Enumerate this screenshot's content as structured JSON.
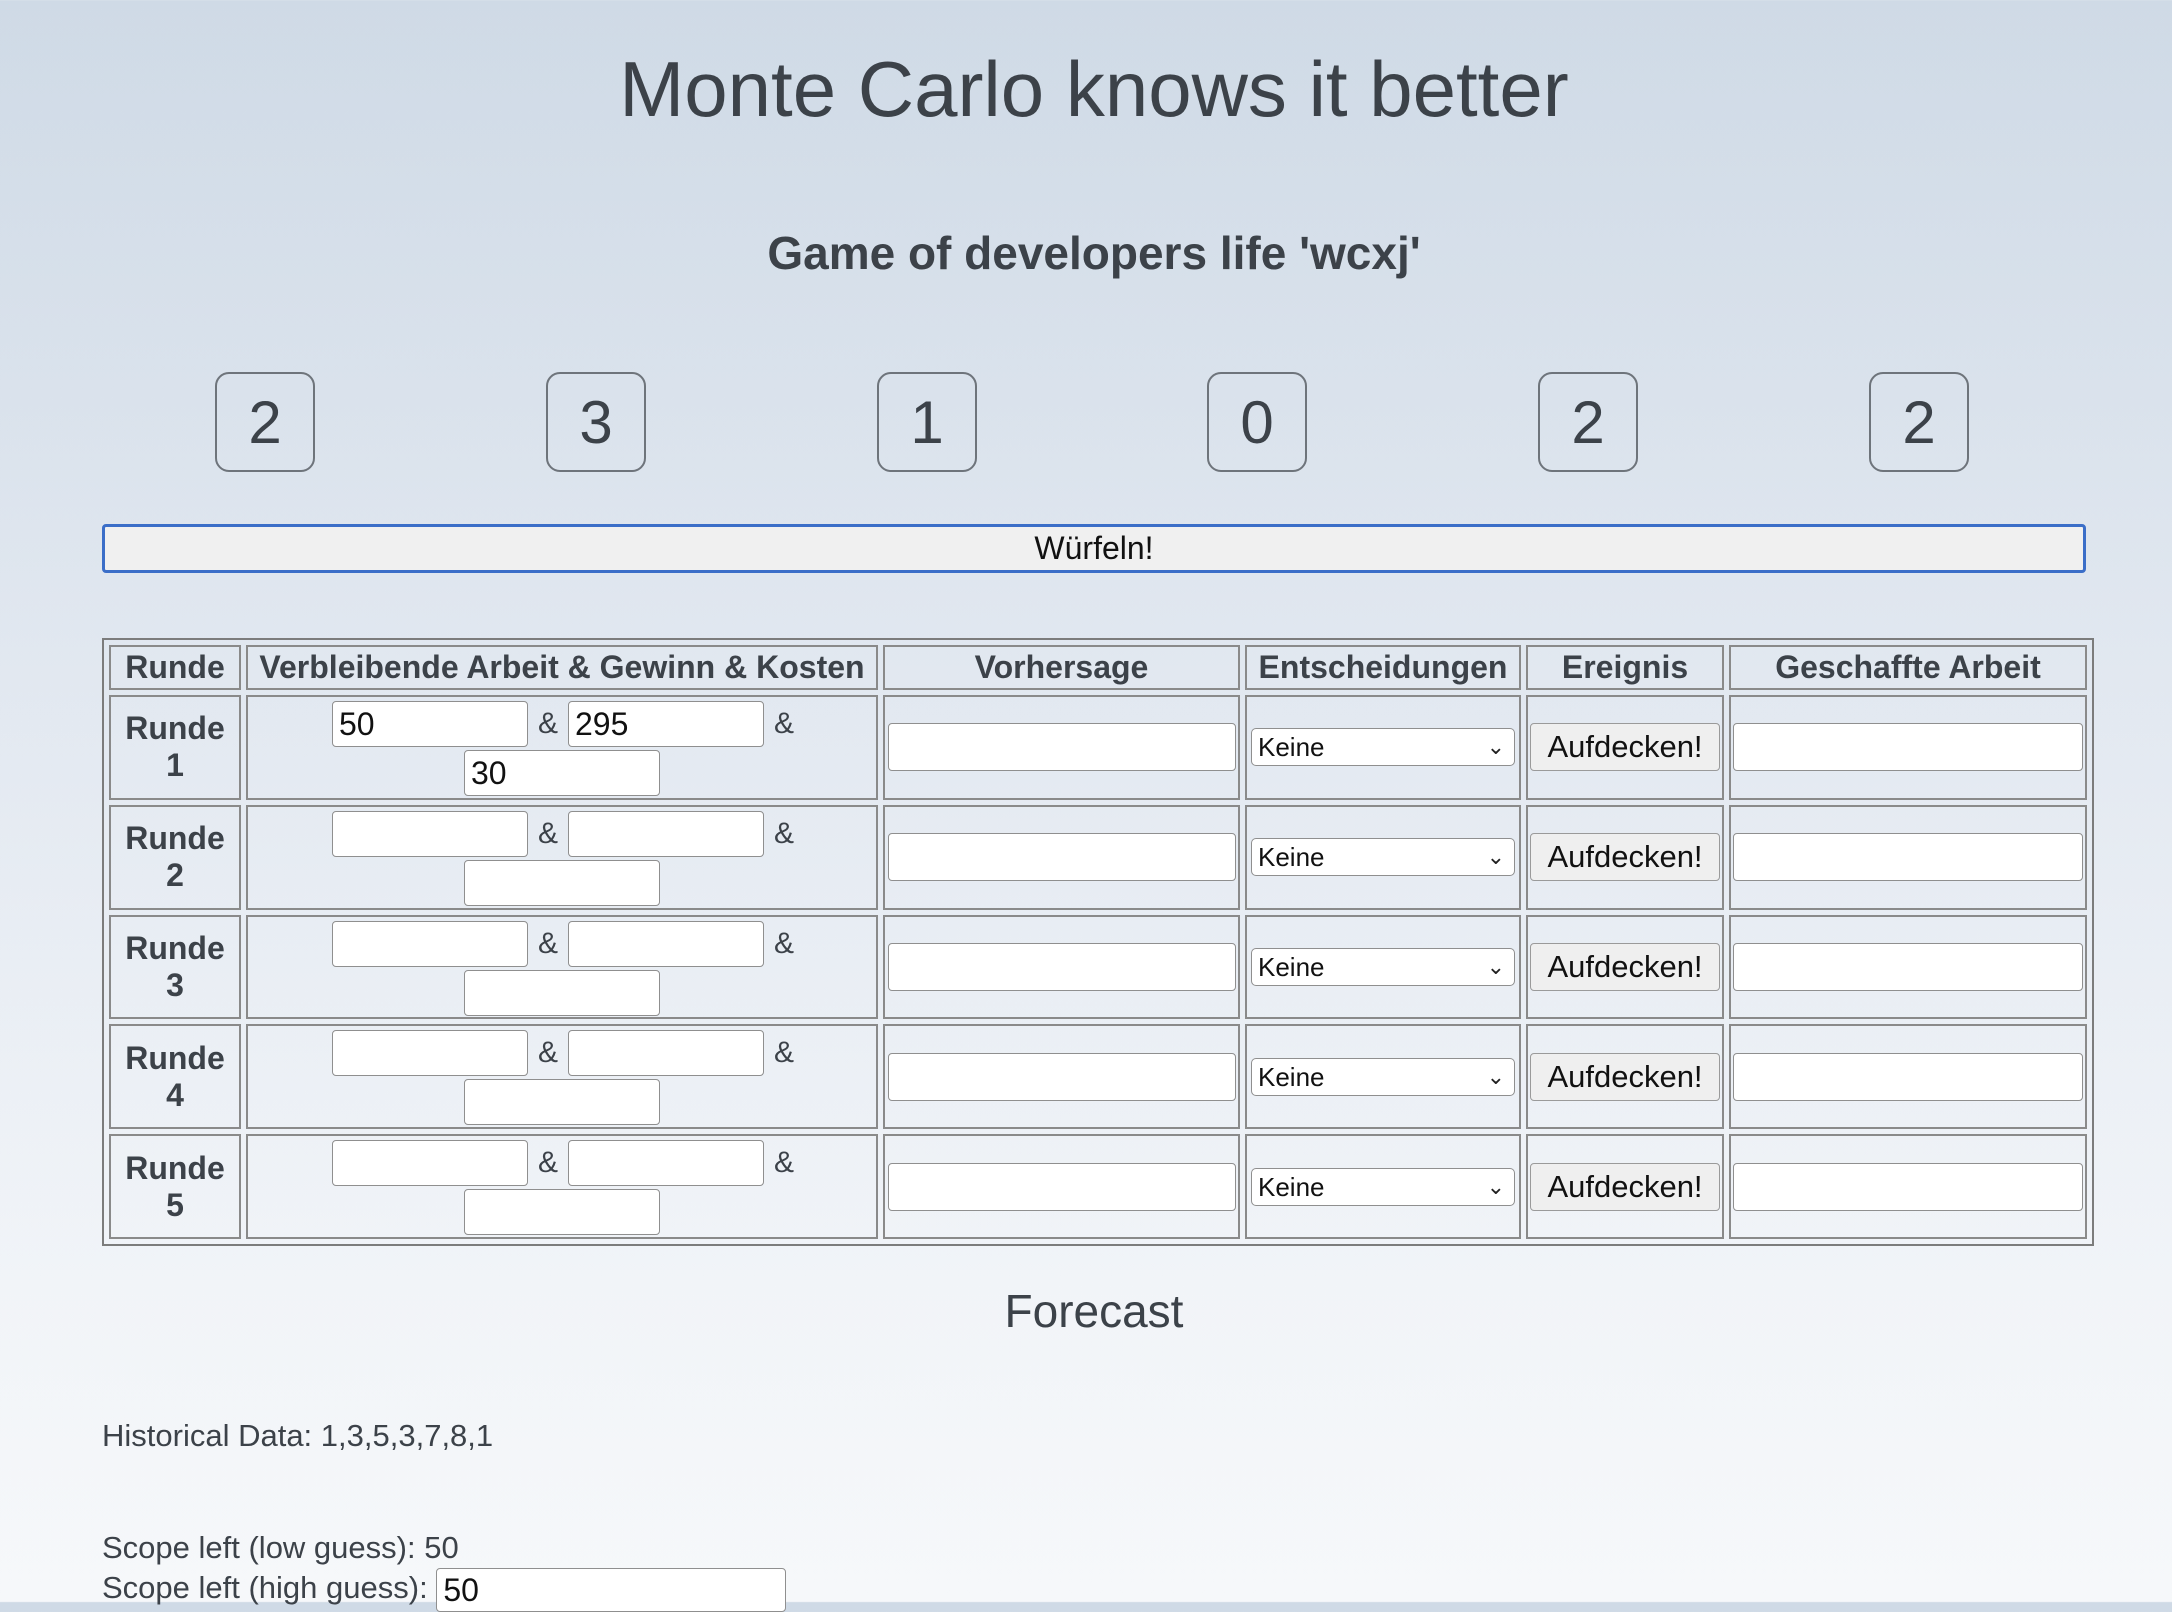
{
  "header": {
    "title": "Monte Carlo knows it better",
    "subtitle": "Game of developers life 'wcxj'"
  },
  "dice": [
    "2",
    "3",
    "1",
    "0",
    "2",
    "2"
  ],
  "roll_button_label": "Würfeln!",
  "table": {
    "headers": [
      "Runde",
      "Verbleibende Arbeit & Gewinn & Kosten",
      "Vorhersage",
      "Entscheidungen",
      "Ereignis",
      "Geschaffte Arbeit"
    ],
    "separator": "&",
    "rows": [
      {
        "round_word": "Runde",
        "round_num": "1",
        "remaining_work": "50",
        "profit": "295",
        "costs": "30",
        "forecast": "",
        "decision": "Keine",
        "event_button": "Aufdecken!",
        "work_done": ""
      },
      {
        "round_word": "Runde",
        "round_num": "2",
        "remaining_work": "",
        "profit": "",
        "costs": "",
        "forecast": "",
        "decision": "Keine",
        "event_button": "Aufdecken!",
        "work_done": ""
      },
      {
        "round_word": "Runde",
        "round_num": "3",
        "remaining_work": "",
        "profit": "",
        "costs": "",
        "forecast": "",
        "decision": "Keine",
        "event_button": "Aufdecken!",
        "work_done": ""
      },
      {
        "round_word": "Runde",
        "round_num": "4",
        "remaining_work": "",
        "profit": "",
        "costs": "",
        "forecast": "",
        "decision": "Keine",
        "event_button": "Aufdecken!",
        "work_done": ""
      },
      {
        "round_word": "Runde",
        "round_num": "5",
        "remaining_work": "",
        "profit": "",
        "costs": "",
        "forecast": "",
        "decision": "Keine",
        "event_button": "Aufdecken!",
        "work_done": ""
      }
    ]
  },
  "forecast": {
    "title": "Forecast",
    "historical_label": "Historical Data: 1,3,5,3,7,8,1",
    "scope_low_label": "Scope left (low guess): 50",
    "scope_high_label": "Scope left (high guess):",
    "scope_high_value": "50"
  },
  "colors": {
    "accent_border": "#3b6ec8",
    "text": "#3c4249"
  }
}
